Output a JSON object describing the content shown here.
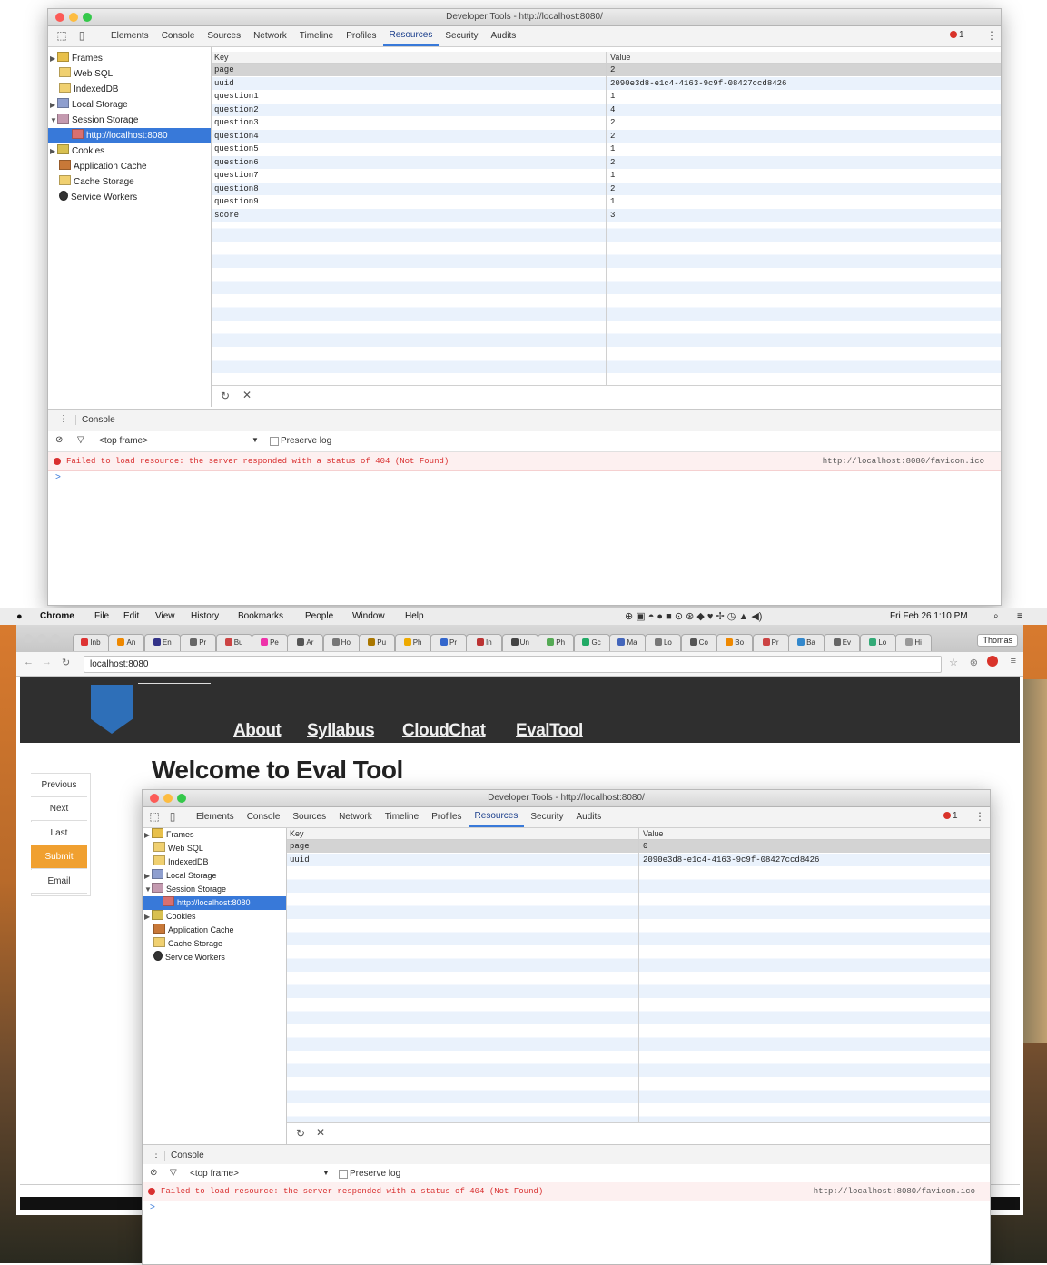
{
  "devtools": {
    "title": "Developer Tools - http://localhost:8080/",
    "tabs": [
      "Elements",
      "Console",
      "Sources",
      "Network",
      "Timeline",
      "Profiles",
      "Resources",
      "Security",
      "Audits"
    ],
    "active_tab": "Resources",
    "error_count": "1",
    "tree": [
      {
        "label": "Frames",
        "arrow": "▶",
        "color": "#e8c04a"
      },
      {
        "label": "Web SQL",
        "arrow": "",
        "color": "#f0d070"
      },
      {
        "label": "IndexedDB",
        "arrow": "",
        "color": "#f0d070"
      },
      {
        "label": "Local Storage",
        "arrow": "▶",
        "color": "#8f9fcf"
      },
      {
        "label": "Session Storage",
        "arrow": "▼",
        "color": "#c49ab0"
      },
      {
        "label": "http://localhost:8080",
        "arrow": "",
        "color": "#d87070"
      },
      {
        "label": "Cookies",
        "arrow": "▶",
        "color": "#d8c050"
      },
      {
        "label": "Application Cache",
        "arrow": "",
        "color": "#c87838"
      },
      {
        "label": "Cache Storage",
        "arrow": "",
        "color": "#f0d070"
      },
      {
        "label": "Service Workers",
        "arrow": "",
        "color": "#333333"
      }
    ],
    "grid": {
      "key_header": "Key",
      "value_header": "Value",
      "rows_top": [
        {
          "key": "page",
          "value": "2"
        },
        {
          "key": "uuid",
          "value": "2090e3d8-e1c4-4163-9c9f-08427ccd8426"
        },
        {
          "key": "question1",
          "value": "1"
        },
        {
          "key": "question2",
          "value": "4"
        },
        {
          "key": "question3",
          "value": "2"
        },
        {
          "key": "question4",
          "value": "2"
        },
        {
          "key": "question5",
          "value": "1"
        },
        {
          "key": "question6",
          "value": "2"
        },
        {
          "key": "question7",
          "value": "1"
        },
        {
          "key": "question8",
          "value": "2"
        },
        {
          "key": "question9",
          "value": "1"
        },
        {
          "key": "score",
          "value": "3"
        }
      ],
      "rows_bottom": [
        {
          "key": "page",
          "value": "0"
        },
        {
          "key": "uuid",
          "value": "2090e3d8-e1c4-4163-9c9f-08427ccd8426"
        }
      ]
    },
    "drawer_tab": "Console",
    "frame_select": "<top frame>",
    "preserve_log": "Preserve log",
    "error_message": "Failed to load resource: the server responded with a status of 404 (Not Found)",
    "error_source": "http://localhost:8080/favicon.ico",
    "prompt": ">"
  },
  "menubar": {
    "apple": "",
    "items": [
      "Chrome",
      "File",
      "Edit",
      "View",
      "History",
      "Bookmarks",
      "People",
      "Window",
      "Help"
    ],
    "clock": "Fri Feb 26  1:10 PM",
    "user": "Thomas"
  },
  "chrome": {
    "url": "localhost:8080",
    "tab_labels": [
      "Inb",
      "An",
      "En",
      "Pr",
      "Bu",
      "Pe",
      "Ar",
      "Ho",
      "Pu",
      "Ph",
      "Pr",
      "In",
      "Un",
      "Ph",
      "Gc",
      "Ma",
      "Lo",
      "Co",
      "Bo",
      "Pr",
      "Ba",
      "Ev",
      "Lo",
      "Hi"
    ]
  },
  "site": {
    "nav": [
      "About",
      "Syllabus",
      "CloudChat",
      "EvalTool"
    ],
    "heading": "Welcome to Eval Tool",
    "buttons": [
      "Previous",
      "Next",
      "Last",
      "Submit",
      "Email"
    ]
  },
  "colors": {
    "accent": "#3879d9",
    "error": "#d93030",
    "submit": "#f0a030",
    "site_header": "#2f2f2f"
  }
}
